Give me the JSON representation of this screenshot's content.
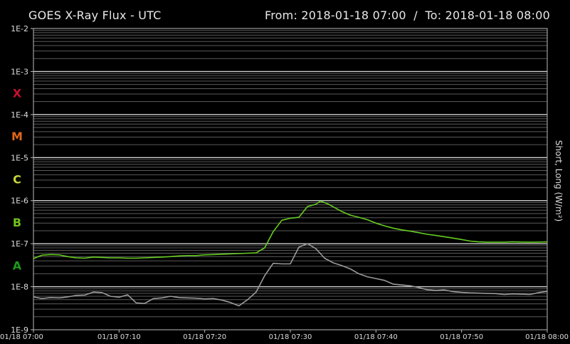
{
  "header": {
    "title": "GOES X-Ray Flux - UTC",
    "range_from_label": "From:",
    "range_from": "2018-01-18 07:00",
    "separator": "/",
    "range_to_label": "To:",
    "range_to": "2018-01-18 08:00"
  },
  "chart_data": {
    "type": "line",
    "title": "GOES X-Ray Flux - UTC",
    "ylabel": "Short, Long (W/m²)",
    "y_scale": "log",
    "ylim": [
      1e-09,
      0.01
    ],
    "y_ticks": [
      "1E-2",
      "1E-3",
      "1E-4",
      "1E-5",
      "1E-6",
      "1E-7",
      "1E-8",
      "1E-9"
    ],
    "x_range_minutes": [
      0,
      60
    ],
    "x_ticks": [
      "01/18 07:00",
      "01/18 07:10",
      "01/18 07:20",
      "01/18 07:30",
      "01/18 07:40",
      "01/18 07:50",
      "01/18 08:00"
    ],
    "grid": true,
    "flare_classes": [
      {
        "label": "X",
        "color": "#c8102e"
      },
      {
        "label": "M",
        "color": "#e0661b"
      },
      {
        "label": "C",
        "color": "#c9d63a"
      },
      {
        "label": "B",
        "color": "#6fc21c"
      },
      {
        "label": "A",
        "color": "#1c9c1c"
      }
    ],
    "series": [
      {
        "name": "Long",
        "color": "#66cc22",
        "x": [
          0,
          1,
          2,
          3,
          4,
          5,
          6,
          7,
          8,
          9,
          10,
          11,
          12,
          13,
          14,
          15,
          16,
          17,
          18,
          19,
          20,
          21,
          22,
          23,
          24,
          25,
          26,
          27,
          28,
          29,
          30,
          31,
          32,
          33,
          33.5,
          34,
          34.5,
          35,
          36,
          37,
          38,
          39,
          40,
          41,
          42,
          43,
          44,
          45,
          46,
          47,
          48,
          49,
          50,
          51,
          52,
          53,
          54,
          55,
          56,
          57,
          58,
          59,
          60
        ],
        "values": [
          4.5e-08,
          5.4e-08,
          5.6e-08,
          5.5e-08,
          5e-08,
          4.7e-08,
          4.6e-08,
          4.9e-08,
          4.8e-08,
          4.7e-08,
          4.7e-08,
          4.6e-08,
          4.6e-08,
          4.7e-08,
          4.8e-08,
          4.9e-08,
          5e-08,
          5.2e-08,
          5.3e-08,
          5.3e-08,
          5.5e-08,
          5.6e-08,
          5.7e-08,
          5.8e-08,
          5.9e-08,
          6e-08,
          6.1e-08,
          8e-08,
          1.9e-07,
          3.5e-07,
          3.9e-07,
          4.1e-07,
          7.3e-07,
          8.3e-07,
          9.7e-07,
          9e-07,
          8.2e-07,
          7.2e-07,
          5.6e-07,
          4.6e-07,
          4.1e-07,
          3.6e-07,
          3e-07,
          2.6e-07,
          2.3e-07,
          2.1e-07,
          1.95e-07,
          1.8e-07,
          1.65e-07,
          1.55e-07,
          1.45e-07,
          1.35e-07,
          1.25e-07,
          1.15e-07,
          1.1e-07,
          1.08e-07,
          1.08e-07,
          1.08e-07,
          1.1e-07,
          1.09e-07,
          1.08e-07,
          1.09e-07,
          1.1e-07
        ]
      },
      {
        "name": "Short",
        "color": "#9a9a9a",
        "x": [
          0,
          1,
          2,
          3,
          4,
          5,
          6,
          7,
          8,
          9,
          10,
          11,
          12,
          13,
          14,
          15,
          16,
          17,
          18,
          19,
          20,
          21,
          22,
          23,
          24,
          25,
          26,
          27,
          28,
          29,
          30,
          31,
          32,
          33,
          34,
          35,
          36,
          37,
          38,
          39,
          40,
          41,
          42,
          43,
          44,
          45,
          46,
          47,
          48,
          49,
          50,
          51,
          52,
          53,
          54,
          55,
          56,
          57,
          58,
          59,
          60
        ],
        "values": [
          5.8e-09,
          5.3e-09,
          5.6e-09,
          5.5e-09,
          5.8e-09,
          6.3e-09,
          6.4e-09,
          7.5e-09,
          7.3e-09,
          6e-09,
          5.7e-09,
          6.5e-09,
          4.2e-09,
          4.1e-09,
          5.3e-09,
          5.5e-09,
          6e-09,
          5.6e-09,
          5.5e-09,
          5.4e-09,
          5.2e-09,
          5.3e-09,
          4.9e-09,
          4.3e-09,
          3.6e-09,
          5e-09,
          7.5e-09,
          1.8e-08,
          3.5e-08,
          3.4e-08,
          3.4e-08,
          8.3e-08,
          1e-07,
          7.6e-08,
          4.6e-08,
          3.6e-08,
          3.1e-08,
          2.6e-08,
          2e-08,
          1.7e-08,
          1.55e-08,
          1.4e-08,
          1.15e-08,
          1.1e-08,
          1.05e-08,
          9.5e-09,
          8.5e-09,
          8.2e-09,
          8.4e-09,
          7.7e-09,
          7.4e-09,
          7.2e-09,
          7.1e-09,
          7e-09,
          6.9e-09,
          6.6e-09,
          6.8e-09,
          6.7e-09,
          6.6e-09,
          7.3e-09,
          7.8e-09
        ]
      }
    ]
  }
}
